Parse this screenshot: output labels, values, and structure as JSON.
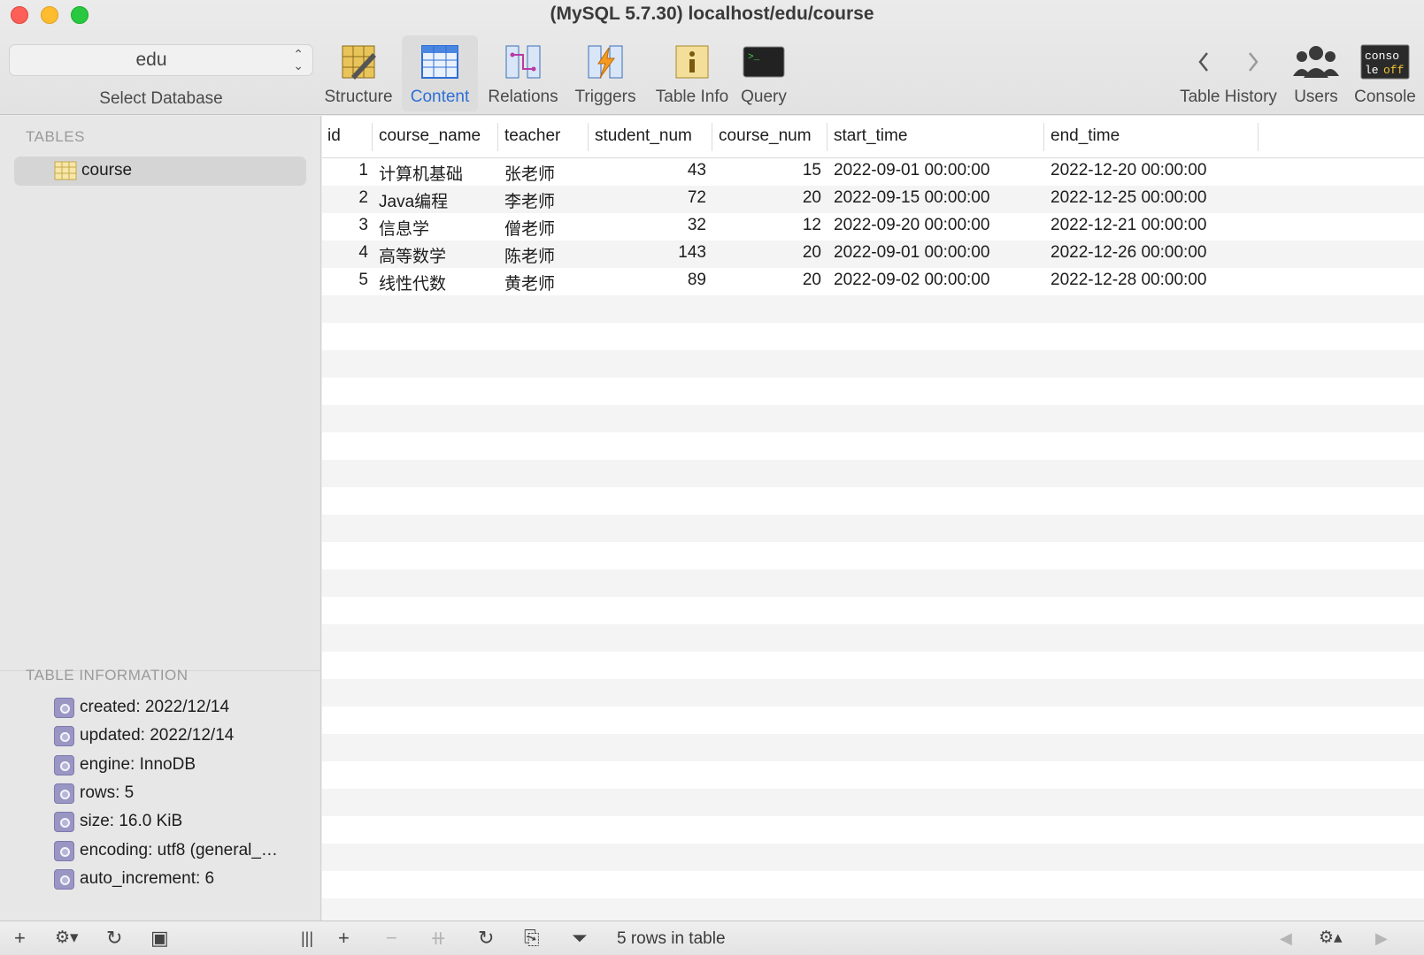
{
  "window": {
    "title": "(MySQL 5.7.30) localhost/edu/course"
  },
  "database": {
    "selected": "edu",
    "caption": "Select Database"
  },
  "toolbar": {
    "structure": "Structure",
    "content": "Content",
    "relations": "Relations",
    "triggers": "Triggers",
    "table_info": "Table Info",
    "query": "Query",
    "table_history": "Table History",
    "users": "Users",
    "console": "Console",
    "console_icon_text_top": "conso",
    "console_icon_text_bottom_a": "le",
    "console_icon_text_bottom_b": "off"
  },
  "sidebar": {
    "tables_heading": "TABLES",
    "tables": [
      "course"
    ],
    "info_heading": "TABLE INFORMATION",
    "info": [
      "created: 2022/12/14",
      "updated: 2022/12/14",
      "engine: InnoDB",
      "rows: 5",
      "size: 16.0 KiB",
      "encoding: utf8 (general_…",
      "auto_increment: 6"
    ]
  },
  "grid": {
    "columns": [
      "id",
      "course_name",
      "teacher",
      "student_num",
      "course_num",
      "start_time",
      "end_time"
    ],
    "rows": [
      [
        "1",
        "计算机基础",
        "张老师",
        "43",
        "15",
        "2022-09-01 00:00:00",
        "2022-12-20 00:00:00"
      ],
      [
        "2",
        "Java编程",
        "李老师",
        "72",
        "20",
        "2022-09-15 00:00:00",
        "2022-12-25 00:00:00"
      ],
      [
        "3",
        "信息学",
        "僧老师",
        "32",
        "12",
        "2022-09-20 00:00:00",
        "2022-12-21 00:00:00"
      ],
      [
        "4",
        "高等数学",
        "陈老师",
        "143",
        "20",
        "2022-09-01 00:00:00",
        "2022-12-26 00:00:00"
      ],
      [
        "5",
        "线性代数",
        "黄老师",
        "89",
        "20",
        "2022-09-02 00:00:00",
        "2022-12-28 00:00:00"
      ]
    ]
  },
  "statusbar": {
    "text": "5 rows in table"
  },
  "colors": {
    "accent": "#2d6fd6",
    "selection": "#d5d5d5",
    "info_icon": "#9a96c4"
  }
}
